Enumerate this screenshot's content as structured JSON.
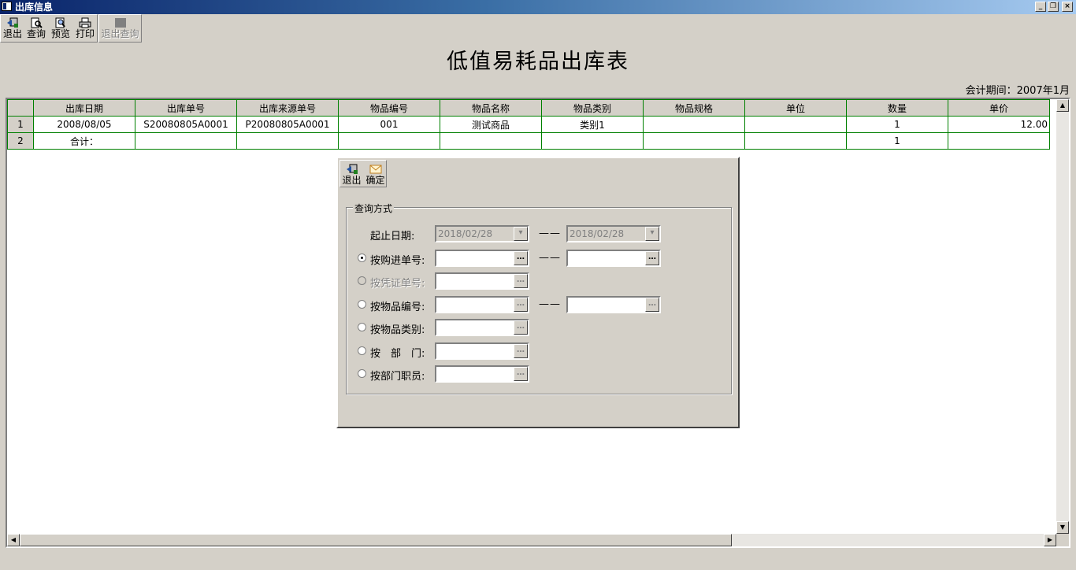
{
  "window": {
    "title": "出库信息",
    "buttons": [
      "_",
      "❐",
      "×"
    ]
  },
  "toolbar": {
    "exit": "退出",
    "query": "查询",
    "preview": "预览",
    "print": "打印",
    "exit_query": "退出查询"
  },
  "report": {
    "title": "低值易耗品出库表",
    "period_label": "会计期间：",
    "period_value": "2007年1月"
  },
  "grid": {
    "columns": [
      "出库日期",
      "出库单号",
      "出库来源单号",
      "物品编号",
      "物品名称",
      "物品类别",
      "物品规格",
      "单位",
      "数量",
      "单价"
    ],
    "rows": [
      {
        "n": "1",
        "date": "2008/08/05",
        "out_no": "S20080805A0001",
        "src_no": "P20080805A0001",
        "item_code": "001",
        "item_name": "测试商品",
        "category": "类别1",
        "spec": "",
        "unit": "",
        "qty": "1",
        "price": "12.00"
      },
      {
        "n": "2",
        "date": "合计：",
        "out_no": "",
        "src_no": "",
        "item_code": "",
        "item_name": "",
        "category": "",
        "spec": "",
        "unit": "",
        "qty": "1",
        "price": ""
      }
    ]
  },
  "dialog": {
    "exit": "退出",
    "ok": "确定",
    "group": "查询方式",
    "date_label": "起止日期:",
    "date_from": "2018/02/28",
    "date_to": "2018/02/28",
    "dash": "——",
    "options": {
      "purchase_no": "按购进单号:",
      "voucher_no": "按凭证单号:",
      "item_code": "按物品编号:",
      "item_category": "按物品类别:",
      "department": "按　部　门:",
      "dept_staff": "按部门职员:"
    },
    "selected": "purchase_no",
    "ellipsis": "…"
  },
  "colors": {
    "grid_line": "#008000",
    "face": "#d4d0c8",
    "title_bar": "#0a246a"
  },
  "icons": [
    "exit-icon",
    "query-icon",
    "preview-icon",
    "print-icon",
    "exit-query-icon",
    "ok-icon"
  ]
}
